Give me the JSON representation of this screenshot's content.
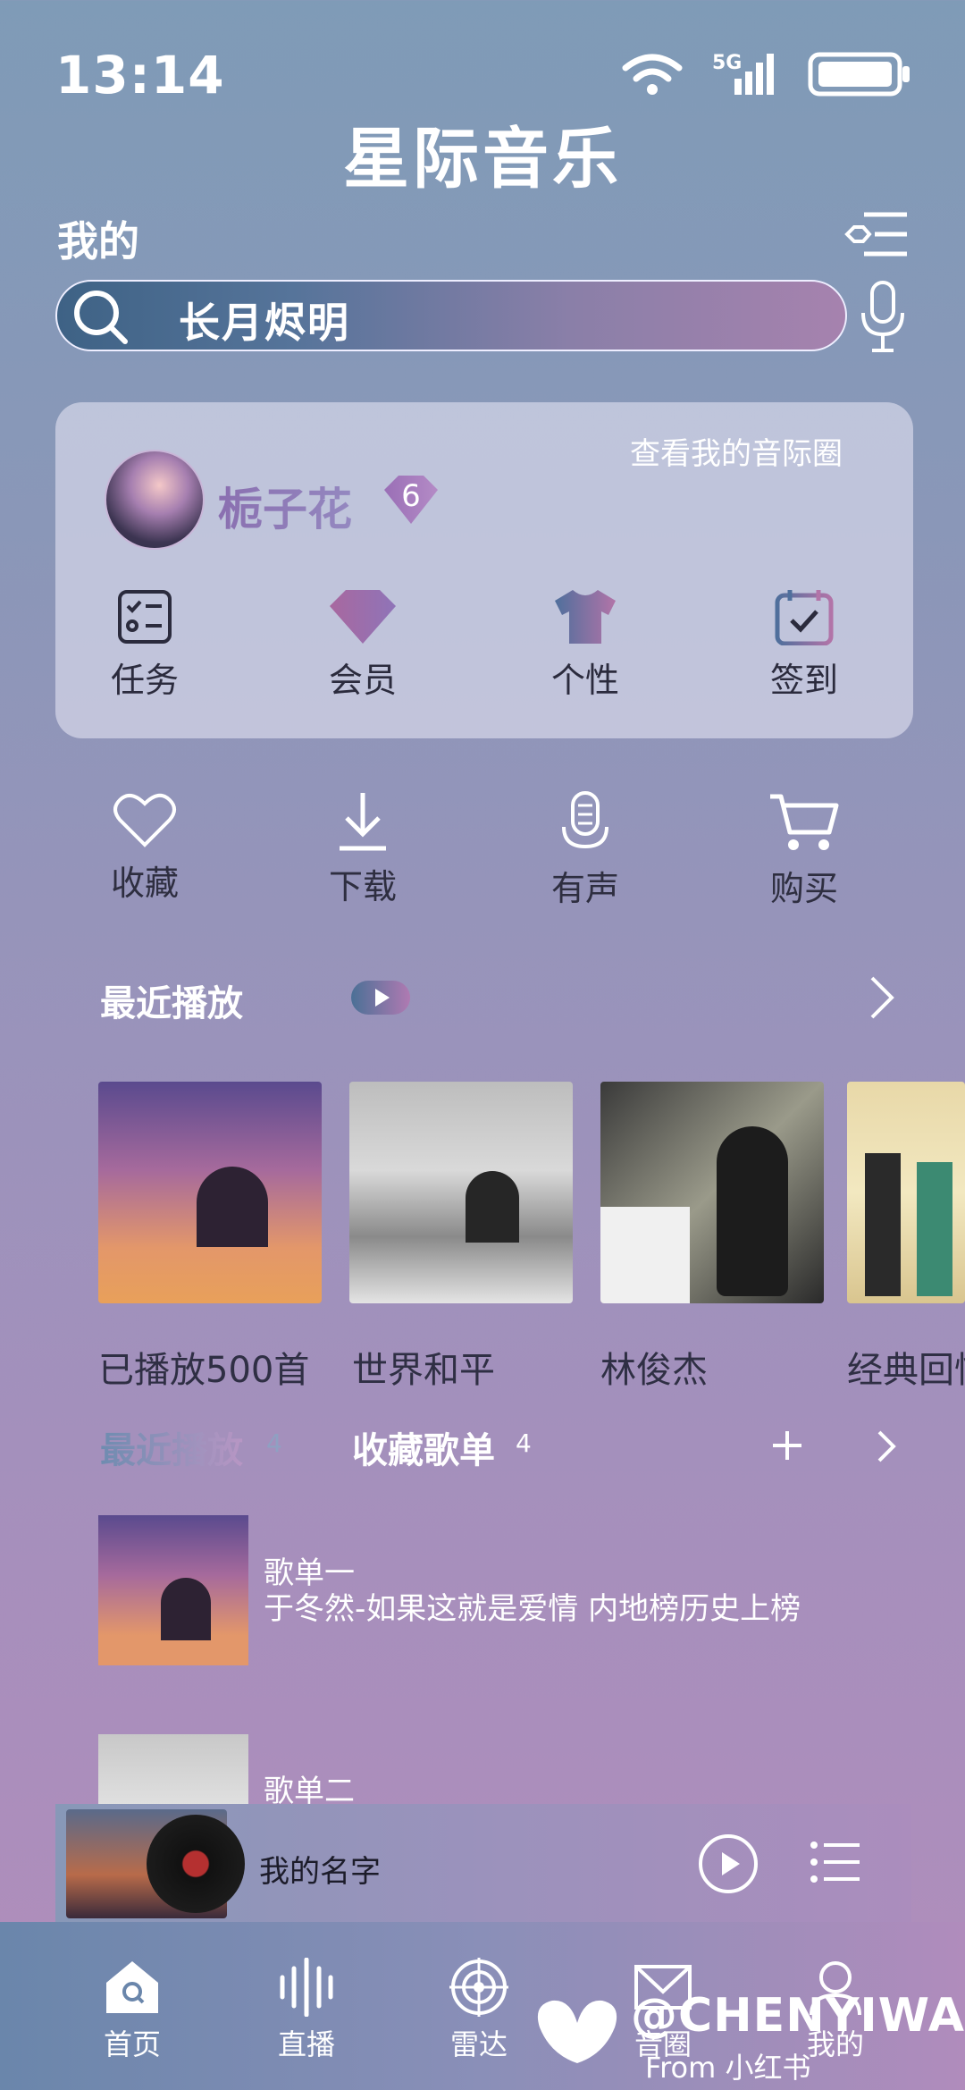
{
  "status_bar": {
    "time": "13:14",
    "network": "5G"
  },
  "app": {
    "title": "星际音乐"
  },
  "header": {
    "section": "我的"
  },
  "search": {
    "query": "长月烬明"
  },
  "profile": {
    "link": "查看我的音际圈",
    "username": "栀子花",
    "level": "6",
    "quick_actions": [
      "任务",
      "会员",
      "个性",
      "签到"
    ]
  },
  "features": [
    "收藏",
    "下载",
    "有声",
    "购买"
  ],
  "recent": {
    "title": "最近播放",
    "albums": [
      {
        "caption": "已播放500首"
      },
      {
        "caption": "世界和平"
      },
      {
        "caption": "林俊杰"
      },
      {
        "caption": "经典回忆"
      }
    ]
  },
  "tabs": {
    "recent_label": "最近播放",
    "recent_count": "4",
    "fav_label": "收藏歌单",
    "fav_count": "4"
  },
  "playlists": [
    {
      "name": "歌单一",
      "desc": "于冬然-如果这就是爱情 内地榜历史上榜"
    },
    {
      "name": "歌单二",
      "desc": ""
    }
  ],
  "player": {
    "song": "我的名字"
  },
  "nav": [
    "首页",
    "直播",
    "雷达",
    "音圈",
    "我的"
  ],
  "watermark": {
    "handle": "@CHENYIWAN",
    "source": "From 小红书"
  },
  "colors": {
    "accent_blue": "#4b7096",
    "accent_pink": "#b07ab2"
  }
}
